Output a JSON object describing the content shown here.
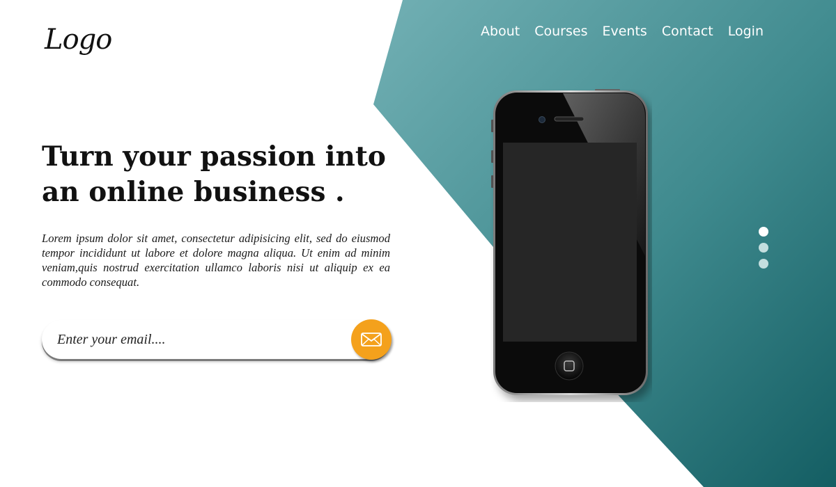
{
  "logo": {
    "text": "Logo"
  },
  "nav": {
    "items": [
      {
        "label": "About"
      },
      {
        "label": "Courses"
      },
      {
        "label": "Events"
      },
      {
        "label": "Contact"
      },
      {
        "label": "Login"
      }
    ]
  },
  "hero": {
    "headline_line1": "Turn your passion into",
    "headline_line2": "an online business .",
    "body": "Lorem ipsum dolor sit amet, consectetur adipisicing elit, sed do eiusmod tempor incididunt ut labore et dolore magna aliqua. Ut enim ad minim veniam,quis nostrud exercitation ullamco laboris nisi ut aliquip ex ea commodo consequat."
  },
  "subscribe": {
    "placeholder": "Enter your email....",
    "button_icon": "envelope-icon"
  },
  "slider": {
    "dot_count": 3,
    "active_index": 0
  },
  "colors": {
    "teal_light": "#6aabb0",
    "teal_dark": "#145e63",
    "accent": "#f4a11c",
    "dot_active": "#ffffff",
    "dot_inactive": "#c4dedf"
  },
  "icons": {
    "logo": "script-logo",
    "phone": "smartphone-mockup"
  }
}
